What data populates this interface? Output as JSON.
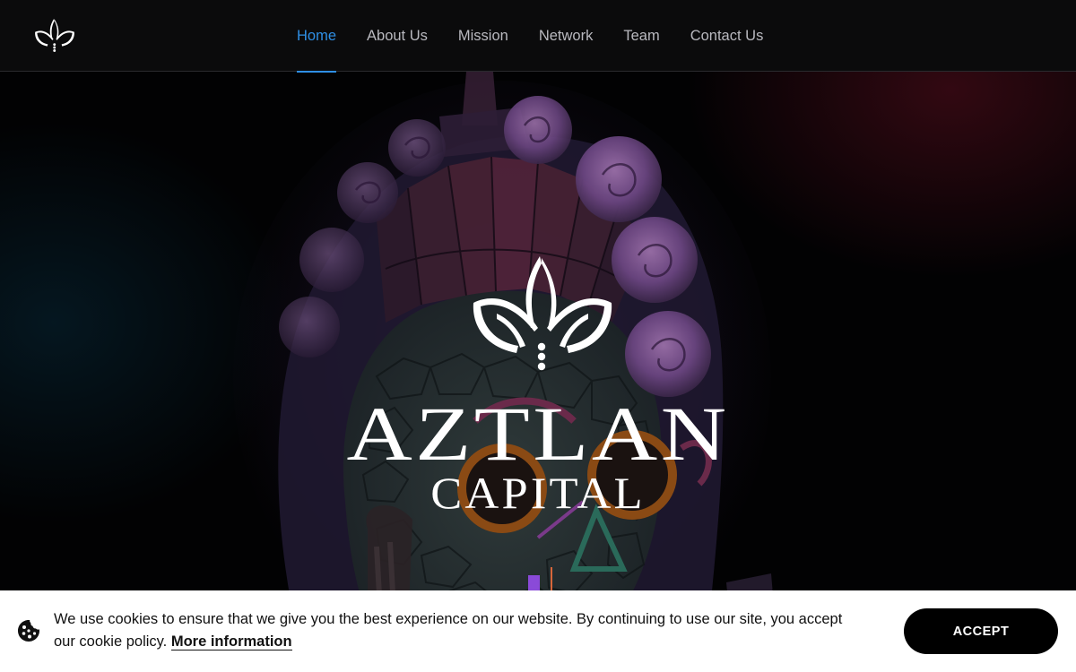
{
  "nav": {
    "logo_icon": "aztlan-lotus-logo-icon",
    "items": [
      {
        "label": "Home",
        "active": true
      },
      {
        "label": "About Us",
        "active": false
      },
      {
        "label": "Mission",
        "active": false
      },
      {
        "label": "Network",
        "active": false
      },
      {
        "label": "Team",
        "active": false
      },
      {
        "label": "Contact Us",
        "active": false
      }
    ]
  },
  "hero": {
    "emblem_icon": "aztlan-lotus-emblem-icon",
    "title": "AZTLAN",
    "subtitle": "CAPITAL",
    "background": "aztec-mask-illustration"
  },
  "cookie": {
    "icon": "cookie-icon",
    "message": "We use cookies to ensure that we give you the best experience on our website. By continuing to use our site, you accept our cookie policy.",
    "more_label": "More information",
    "accept_label": "ACCEPT"
  },
  "colors": {
    "accent": "#2f8fe5",
    "nav_background": "#0b0b0c",
    "nav_text": "#b9b9bf",
    "cookie_background": "#ffffff",
    "button_background": "#000000"
  }
}
